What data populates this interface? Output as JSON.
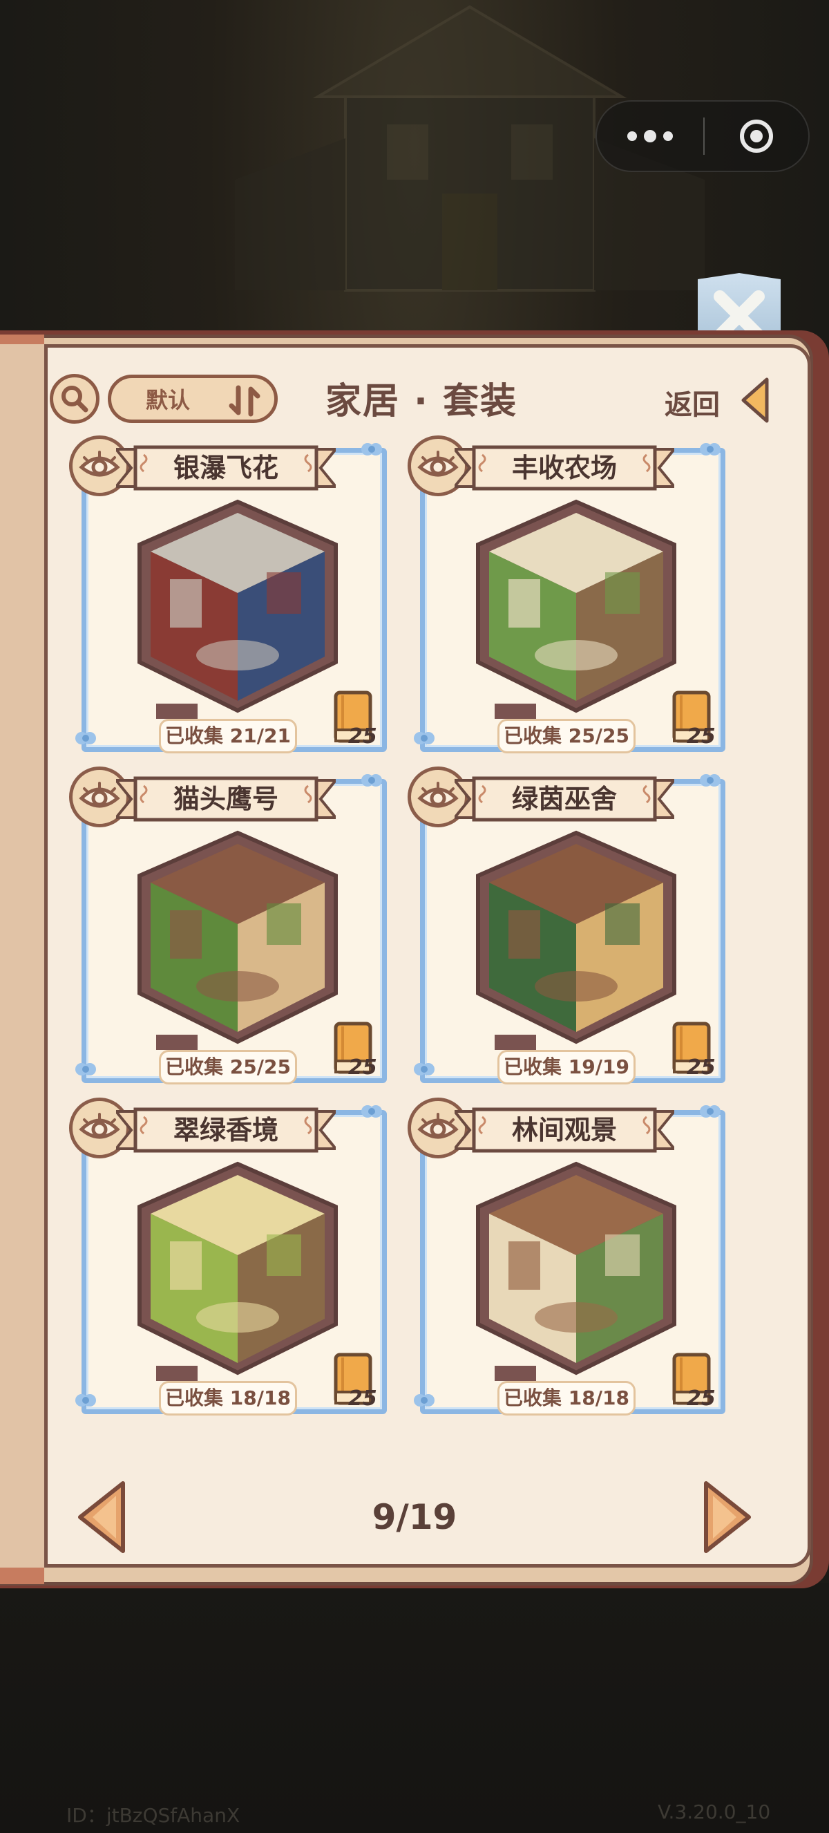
{
  "header": {
    "sort_label": "默认",
    "title": "家居 · 套装",
    "back_label": "返回"
  },
  "cards": [
    {
      "name": "银瀑飞花",
      "collected": "已收集 21/21",
      "book_count": "25",
      "palette": [
        "#8a3b34",
        "#c6c0b6",
        "#3a4e78"
      ]
    },
    {
      "name": "丰收农场",
      "collected": "已收集 25/25",
      "book_count": "25",
      "palette": [
        "#6f9a4a",
        "#e8dcc0",
        "#8a6a4a"
      ]
    },
    {
      "name": "猫头鹰号",
      "collected": "已收集 25/25",
      "book_count": "25",
      "palette": [
        "#5f8a3c",
        "#8a5a44",
        "#d9b88a"
      ]
    },
    {
      "name": "绿茵巫舍",
      "collected": "已收集 19/19",
      "book_count": "25",
      "palette": [
        "#3f6a3c",
        "#8a5a40",
        "#d8b070"
      ]
    },
    {
      "name": "翠绿香境",
      "collected": "已收集 18/18",
      "book_count": "25",
      "palette": [
        "#9ab64e",
        "#e8d9a0",
        "#8a6a48"
      ]
    },
    {
      "name": "林间观景",
      "collected": "已收集 18/18",
      "book_count": "25",
      "palette": [
        "#e8d8b8",
        "#9a6a4a",
        "#6a8a4a"
      ]
    }
  ],
  "pager": {
    "text": "9/19"
  },
  "footer": {
    "id": "ID：jtBzQSfAhanX",
    "version": "V.3.20.0_10"
  },
  "colors": {
    "frame_blue": "#8bb6e3",
    "page_bg": "#f7ecde",
    "brown": "#8d5a45"
  }
}
